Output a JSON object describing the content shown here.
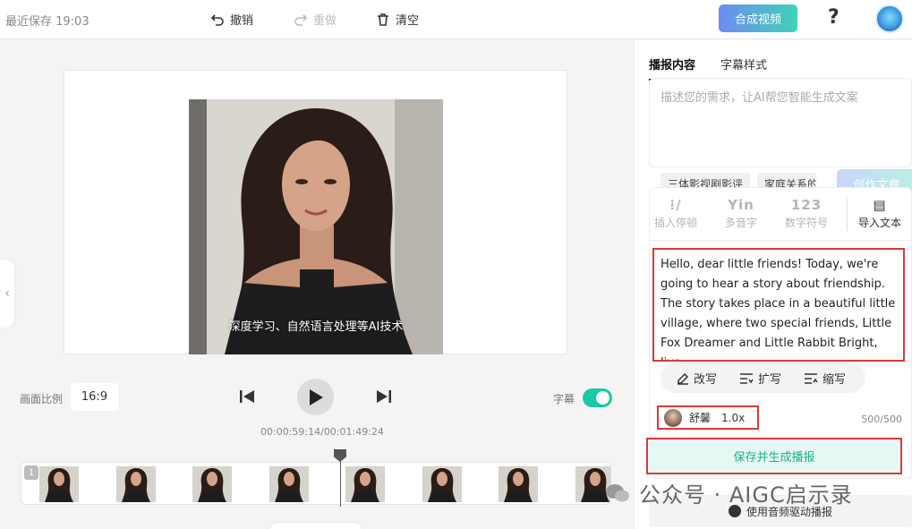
{
  "header": {
    "save_status": "最近保存 19:03",
    "undo_label": "撤销",
    "redo_label": "重做",
    "clear_label": "清空",
    "compose_label": "合成视频",
    "help_label": "?"
  },
  "canvas": {
    "subtitle": "深度学习、自然语言处理等AI技术"
  },
  "controls": {
    "ratio_label": "画面比例",
    "ratio_value": "16:9",
    "subtitle_label": "字幕",
    "subtitle_on": true,
    "time": "00:00:59:14/00:01:49:24"
  },
  "timeline": {
    "track_number": "1",
    "thumb_count": 8
  },
  "panel": {
    "tabs": [
      {
        "label": "播报内容",
        "active": true
      },
      {
        "label": "字幕样式",
        "active": false
      }
    ],
    "prompt_placeholder": "描述您的需求，让AI帮您智能生成文案",
    "chips": [
      "三体影视剧影评",
      "家庭关系的"
    ],
    "create_label": "创作文章",
    "tools": [
      {
        "label": "插入停顿",
        "glyph": "⁞/",
        "icon": "pause-insert-icon"
      },
      {
        "label": "多音字",
        "glyph": "Yin",
        "icon": "polyphone-icon"
      },
      {
        "label": "数字符号",
        "glyph": "123",
        "icon": "number-icon"
      },
      {
        "label": "导入文本",
        "glyph": "▤",
        "icon": "import-text-icon"
      }
    ],
    "script_text": "Hello, dear little friends! Today, we're going to hear a story about friendship. The story takes place in a beautiful little village, where two special friends, Little Fox Dreamer and Little Rabbit Bright, live.",
    "rewrite_label": "改写",
    "expand_label": "扩写",
    "shorten_label": "缩写",
    "voice_name": "舒馨",
    "voice_speed": "1.0x",
    "char_count": "500/500",
    "save_generate_label": "保存并生成播报",
    "audio_drive_label": "使用音频驱动播报"
  },
  "watermark": "公众号 · AIGC启示录",
  "colors": {
    "accent_green": "#19c8a4",
    "highlight_red": "#d93a3a",
    "compose_gradient_start": "#6e8bf5",
    "compose_gradient_end": "#3fd3b5"
  }
}
